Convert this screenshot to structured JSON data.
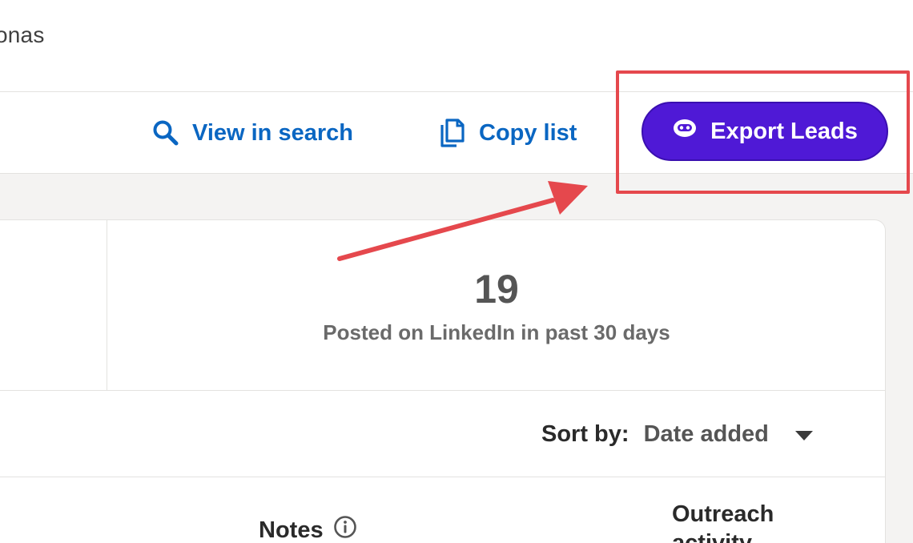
{
  "header": {
    "title": "onas"
  },
  "actions": {
    "view_in_search": "View in search",
    "copy_list": "Copy list",
    "export_leads": "Export Leads"
  },
  "stats": {
    "posted_count": "19",
    "posted_label": "Posted on LinkedIn in past 30 days"
  },
  "sort": {
    "label": "Sort by:",
    "value": "Date added"
  },
  "table": {
    "columns": {
      "notes": "Notes",
      "outreach_activity": "Outreach activity"
    }
  },
  "colors": {
    "link": "#0a66c2",
    "export_button": "#4f19d6",
    "annotation": "#e5484d"
  },
  "icons": [
    "search-icon",
    "copy-icon",
    "robot-icon",
    "caret-down-icon",
    "info-icon",
    "annotation-arrow"
  ]
}
